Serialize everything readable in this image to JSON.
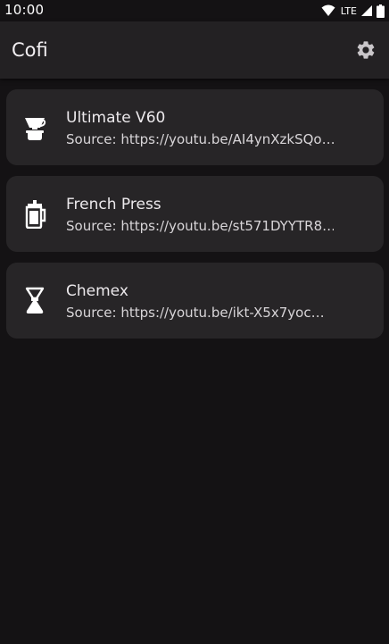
{
  "status_bar": {
    "time": "10:00",
    "network": "LTE"
  },
  "app_bar": {
    "title": "Cofi",
    "settings_icon": "gear-icon"
  },
  "recipes": [
    {
      "name": "Ultimate V60",
      "source": "Source: https://youtu.be/AI4ynXzkSQo…",
      "icon": "v60-dripper-icon"
    },
    {
      "name": "French Press",
      "source": "Source: https://youtu.be/st571DYYTR8…",
      "icon": "french-press-icon"
    },
    {
      "name": "Chemex",
      "source": "Source: https://youtu.be/ikt-X5x7yoc…",
      "icon": "chemex-icon"
    }
  ],
  "colors": {
    "background": "#141214",
    "app_bar": "#232123",
    "card": "#272527",
    "text": "#ece9ec"
  }
}
